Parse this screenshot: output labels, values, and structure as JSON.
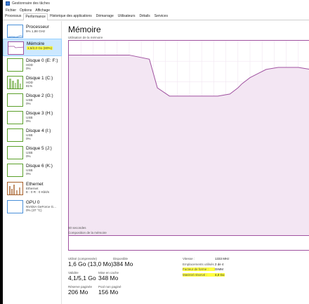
{
  "window": {
    "title": "Gestionnaire des tâches"
  },
  "menu": [
    "Fichier",
    "Options",
    "Affichage"
  ],
  "tabs": [
    {
      "label": "Processus",
      "active": false
    },
    {
      "label": "Performance",
      "active": true
    },
    {
      "label": "Historique des applications",
      "active": false
    },
    {
      "label": "Démarrage",
      "active": false
    },
    {
      "label": "Utilisateurs",
      "active": false
    },
    {
      "label": "Détails",
      "active": false
    },
    {
      "label": "Services",
      "active": false
    }
  ],
  "sidebar": {
    "items": [
      {
        "title": "Processeur",
        "lines": [
          "5% 1,88 GHz"
        ],
        "kind": "cpu"
      },
      {
        "title": "Mémoire",
        "lines": [
          "1,6/2,0 Go (80%)"
        ],
        "kind": "mem"
      },
      {
        "title": "Disque 0 (E: F:)",
        "lines": [
          "HDD",
          "0%"
        ],
        "kind": "disk"
      },
      {
        "title": "Disque 1 (C:)",
        "lines": [
          "HDD",
          "81%"
        ],
        "kind": "disk"
      },
      {
        "title": "Disque 2 (G:)",
        "lines": [
          "USB",
          "0%"
        ],
        "kind": "disk"
      },
      {
        "title": "Disque 3 (H:)",
        "lines": [
          "USB",
          "0%"
        ],
        "kind": "disk"
      },
      {
        "title": "Disque 4 (I:)",
        "lines": [
          "USB",
          "0%"
        ],
        "kind": "disk"
      },
      {
        "title": "Disque 5 (J:)",
        "lines": [
          "USB",
          "0%"
        ],
        "kind": "disk"
      },
      {
        "title": "Disque 6 (K:)",
        "lines": [
          "USB",
          "0%"
        ],
        "kind": "disk"
      },
      {
        "title": "Ethernet",
        "lines": [
          "Ethernet",
          "E : 0 R : 0 Kbit/s"
        ],
        "kind": "eth"
      },
      {
        "title": "GPU 0",
        "lines": [
          "NVIDIA GeForce G...",
          "0% (37 °C)"
        ],
        "kind": "gpu"
      }
    ]
  },
  "main": {
    "title": "Mémoire",
    "graph_label": "Utilisation de la mémoire",
    "time_label": "60 secondes",
    "composition_label": "Composition de la mémoire"
  },
  "stats": {
    "in_use_label": "Utilisé (compressée)",
    "in_use_value": "1,6 Go (13,0 Mo)",
    "available_label": "Disponible",
    "available_value": "384 Mo",
    "committed_label": "Validée",
    "committed_value": "4,1/5,1 Go",
    "cached_label": "Mise en cache",
    "cached_value": "348 Mo",
    "paged_label": "Réserve paginée",
    "paged_value": "206 Mo",
    "nonpaged_label": "Pool non paginé",
    "nonpaged_value": "156 Mo"
  },
  "details": [
    {
      "key": "Vitesse :",
      "value": "1333 MHz"
    },
    {
      "key": "Emplacements utilisés :",
      "value": "2 de 4"
    },
    {
      "key": "Facteur de forme :",
      "value": "DIMM"
    },
    {
      "key": "Matériel réservé :",
      "value": "4,0 Go"
    }
  ],
  "chart_data": {
    "type": "area",
    "title": "",
    "ylim": [
      0,
      100
    ],
    "x_unit": "seconds",
    "xlim": [
      -60,
      0
    ],
    "x": [
      -60,
      -45,
      -40,
      -38,
      -35,
      -33,
      -25,
      -23,
      -20,
      -18,
      -17,
      -15,
      -13,
      -11,
      -8,
      -6,
      -3,
      0
    ],
    "values": [
      93,
      93,
      91,
      77,
      73,
      73,
      73,
      73,
      74,
      77,
      79,
      82,
      84,
      86,
      87,
      87,
      87,
      86
    ]
  }
}
